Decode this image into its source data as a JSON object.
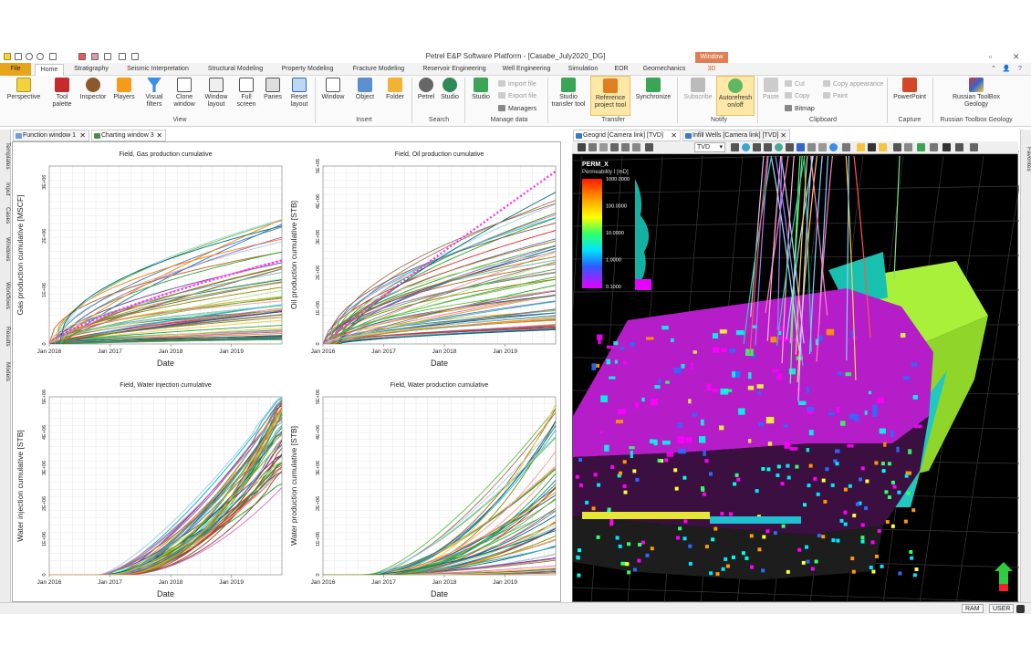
{
  "window": {
    "title": "Petrel E&P Software Platform - [Casabe_July2020_DG]",
    "context_tab": "Window"
  },
  "tabs": [
    {
      "label": "File"
    },
    {
      "label": "Home"
    },
    {
      "label": "Stratigraphy"
    },
    {
      "label": "Seismic Interpretation"
    },
    {
      "label": "Structural Modeling"
    },
    {
      "label": "Property Modeling"
    },
    {
      "label": "Fracture Modeling"
    },
    {
      "label": "Reservoir Engineering"
    },
    {
      "label": "Well Engineering"
    },
    {
      "label": "Simulation"
    },
    {
      "label": "EOR"
    },
    {
      "label": "Geomechanics"
    },
    {
      "label": "3D"
    }
  ],
  "ribbon": {
    "view": {
      "label": "View",
      "buttons": [
        "Perspective",
        "Tool palette",
        "Inspector",
        "Players",
        "Visual filters",
        "Clone window",
        "Window layout",
        "Full screen",
        "Panes",
        "Reset layout"
      ]
    },
    "insert": {
      "label": "Insert",
      "buttons": [
        "Window",
        "Object",
        "Folder"
      ]
    },
    "search": {
      "label": "Search",
      "buttons": [
        "Petrel",
        "Studio"
      ]
    },
    "manage": {
      "label": "Manage data",
      "buttons": [
        "Studio"
      ],
      "small": [
        "Import file",
        "Export file",
        "Managers"
      ]
    },
    "transfer": {
      "label": "Transfer",
      "buttons": [
        "Studio transfer tool",
        "Reference project tool",
        "Synchronize"
      ]
    },
    "notify": {
      "label": "Notify",
      "buttons": [
        "Subscribe",
        "Autorefresh on/off"
      ]
    },
    "clipboard": {
      "label": "Clipboard",
      "buttons": [
        "Paste"
      ],
      "small": [
        "Cut",
        "Copy",
        "Bitmap",
        "Copy appearance",
        "Paint"
      ]
    },
    "capture": {
      "label": "Capture",
      "buttons": [
        "PowerPoint"
      ]
    },
    "russian": {
      "label": "Russian Toolbox Geology",
      "buttons": [
        "Russian ToolBox Geology"
      ]
    }
  },
  "left_panes": [
    "Templates",
    "Input",
    "Cases",
    "Windows",
    "Workflows",
    "Results",
    "Models"
  ],
  "right_panes": [
    "Favorites"
  ],
  "window_tabs": [
    "Function window 1",
    "Charting window 3",
    "Geogrid [Camera link] [TVD]",
    "Infill Wells [Camera link] [TVD]"
  ],
  "viewer_toolbar": {
    "depth_mode": "TVD"
  },
  "legend3d": {
    "property": "PERM_X",
    "subtitle": "Permeability I [mD]",
    "ticks": [
      "1000.0000",
      "100.0000",
      "10.0000",
      "1.0000",
      "0.1000"
    ]
  },
  "status": {
    "ram": "RAM",
    "user": "USER"
  },
  "colors": {
    "file_tab": "#e8a41a",
    "context": "#e07f55",
    "perm_purple": "#b41dc8",
    "accent": "#f5c542"
  },
  "chart_data": [
    {
      "type": "line",
      "title": "Field, Gas production cumulative",
      "xlabel": "Date",
      "ylabel": "Gas production cumulative [MSCF]",
      "xticks": [
        "Jan 2016",
        "Jan 2017",
        "Jan 2018",
        "Jan 2019"
      ],
      "yticks": [
        "0",
        "1E+06",
        "2E+06",
        "3E+06"
      ],
      "xlim": [
        "2016-01",
        "2019-11"
      ],
      "ylim": [
        0,
        3300000
      ],
      "grid": true,
      "series_summary": {
        "count": 70,
        "envelope_max_end": 2350000,
        "envelope_min_end": 80000,
        "highlight_dotted_end": 1550000,
        "onset": "2016-01"
      }
    },
    {
      "type": "line",
      "title": "Field, Oil production cumulative",
      "xlabel": "Date",
      "ylabel": "Oil production cumulative [STB]",
      "xticks": [
        "Jan 2016",
        "Jan 2017",
        "Jan 2018",
        "Jan 2019"
      ],
      "yticks": [
        "0",
        "1E+06",
        "2E+06",
        "3E+06",
        "4E+06",
        "5E+06"
      ],
      "xlim": [
        "2016-01",
        "2019-11"
      ],
      "ylim": [
        0,
        5000000
      ],
      "grid": true,
      "series_summary": {
        "count": 70,
        "envelope_max_end": 4300000,
        "envelope_min_end": 400000,
        "highlight_dotted_end": 4850000,
        "onset": "2016-01"
      }
    },
    {
      "type": "line",
      "title": "Field, Water injection cumulative",
      "xlabel": "Date",
      "ylabel": "Water injection cumulative [STB]",
      "xticks": [
        "Jan 2016",
        "Jan 2017",
        "Jan 2018",
        "Jan 2019"
      ],
      "yticks": [
        "0",
        "1E+06",
        "2E+06",
        "3E+06",
        "4E+06",
        "5E+06"
      ],
      "xlim": [
        "2016-01",
        "2019-11"
      ],
      "ylim": [
        0,
        5000000
      ],
      "grid": true,
      "series_summary": {
        "count": 60,
        "envelope_max_end": 5000000,
        "envelope_min_end": 2400000,
        "onset": "2016-11"
      }
    },
    {
      "type": "line",
      "title": "Field, Water production cumulative",
      "xlabel": "Date",
      "ylabel": "Water production cumulative [STB]",
      "xticks": [
        "Jan 2016",
        "Jan 2017",
        "Jan 2018",
        "Jan 2019"
      ],
      "yticks": [
        "0",
        "1E+06",
        "2E+06",
        "3E+06",
        "4E+06",
        "5E+06"
      ],
      "xlim": [
        "2016-01",
        "2019-11"
      ],
      "ylim": [
        0,
        5000000
      ],
      "grid": true,
      "series_summary": {
        "count": 70,
        "envelope_max_end": 4900000,
        "envelope_min_end": 50000,
        "onset": "2016-09"
      }
    }
  ]
}
